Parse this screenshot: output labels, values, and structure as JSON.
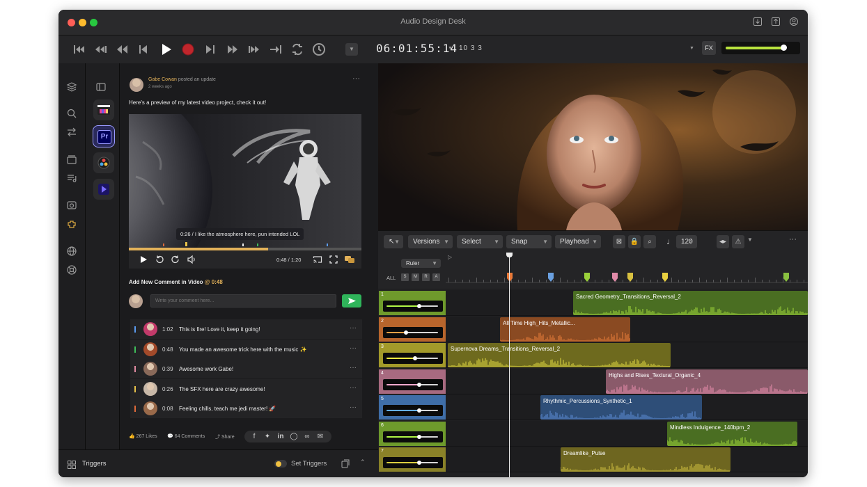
{
  "window": {
    "title": "Audio Design Desk"
  },
  "transport": {
    "timecode": "06:01:55:14",
    "bars": "10 3 3",
    "fx_label": "FX",
    "volume": 0.83
  },
  "feed": {
    "author": "Gabe Cowan",
    "action": "posted an update",
    "time": "2 weeks ago",
    "post_text": "Here's a preview of my latest video project, check it out!",
    "video_comment": "0:26 / I like the atmosphere here, pun intended LOL",
    "player_time": "0:48 / 1:20",
    "player_progress": 0.6,
    "add_comment_prefix": "Add New Comment in Video",
    "add_comment_time": "@ 0:48",
    "comment_placeholder": "Write your comment here...",
    "comments": [
      {
        "time": "1:02",
        "text": "This is fire! Love it, keep it going!",
        "color": "#5b9cf0"
      },
      {
        "time": "0:48",
        "text": "You made an awesome trick here with the music ✨",
        "color": "#3fbf5a"
      },
      {
        "time": "0:39",
        "text": "Awesome work Gabe!",
        "color": "#e08aa0"
      },
      {
        "time": "0:26",
        "text": "The SFX here are crazy awesome!",
        "color": "#e8c24a"
      },
      {
        "time": "0:08",
        "text": "Feeling chills, teach me jedi master! 🚀",
        "color": "#e06a3a"
      }
    ],
    "likes": "267 Likes",
    "comments_count": "64 Comments",
    "share": "Share"
  },
  "triggers": {
    "label": "Triggers",
    "set_label": "Set Triggers"
  },
  "toolbar": {
    "versions": "Versions",
    "select": "Select",
    "snap": "Snap",
    "playhead": "Playhead",
    "tempo": "120"
  },
  "timeline": {
    "ruler_label": "Ruler",
    "all_label": "ALL",
    "solo_buttons": [
      "S",
      "M",
      "R",
      "A"
    ],
    "tracks": [
      {
        "num": "1",
        "color": "#6f9a2c",
        "level": 0.64,
        "clip": "Sacred Geometry_Transitions_Reversal_2"
      },
      {
        "num": "2",
        "color": "#b8652c",
        "level": 0.38,
        "clip": "All Time High_Hits_Metallic..."
      },
      {
        "num": "3",
        "color": "#a39a2a",
        "level": 0.55,
        "clip": "Supernova Dreams_Transitions_Reversal_2"
      },
      {
        "num": "4",
        "color": "#a86a80",
        "level": 0.64,
        "clip": "Highs and Rises_Textural_Organic_4"
      },
      {
        "num": "5",
        "color": "#3f6ea8",
        "level": 0.64,
        "clip": "Rhythmic_Percussions_Synthetic_1"
      },
      {
        "num": "6",
        "color": "#6e9a2c",
        "level": 0.64,
        "clip": "Mindless Indulgence_140bpm_2"
      },
      {
        "num": "7",
        "color": "#8a8228",
        "level": 0.64,
        "clip": "Dreamlike_Pulse"
      }
    ]
  }
}
